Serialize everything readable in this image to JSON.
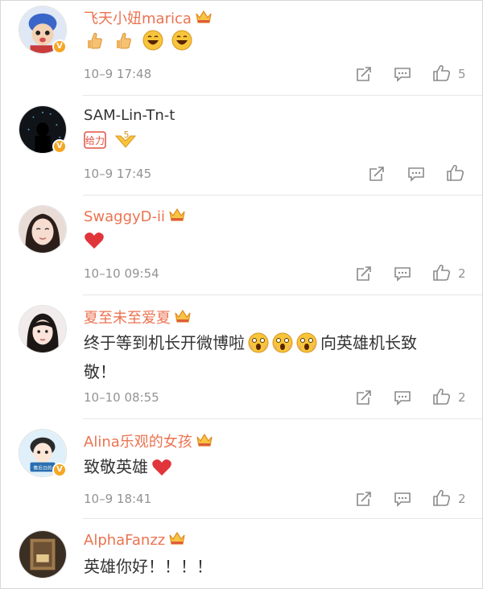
{
  "accent_color": "#eb7350",
  "comments": [
    {
      "name": "飞天小妞marica",
      "text": "",
      "time": "10–9 17:48",
      "likes": "5"
    },
    {
      "name": "SAM-Lin-Tn-t",
      "text": "",
      "time": "10–9 17:45",
      "likes": ""
    },
    {
      "name": "SwaggyD-ii",
      "text": "",
      "time": "10–10 09:54",
      "likes": "2"
    },
    {
      "name": "夏至未至爱夏",
      "text_line1": "终于等到机长开微博啦",
      "text_line1_end": "向英雄机长致",
      "text_line2": "敬！",
      "time": "10–10 08:55",
      "likes": "2"
    },
    {
      "name": "Alina乐观的女孩",
      "text": "致敬英雄",
      "time": "10–9 18:41",
      "likes": "2"
    },
    {
      "name": "AlphaFanzz",
      "text": "英雄你好！！！！"
    }
  ],
  "badge": {
    "verified_glyph": "V"
  },
  "sticker": {
    "fight_text": "给力",
    "arrow_text": "5"
  },
  "avatar_text": {
    "alina": "像后日的"
  }
}
